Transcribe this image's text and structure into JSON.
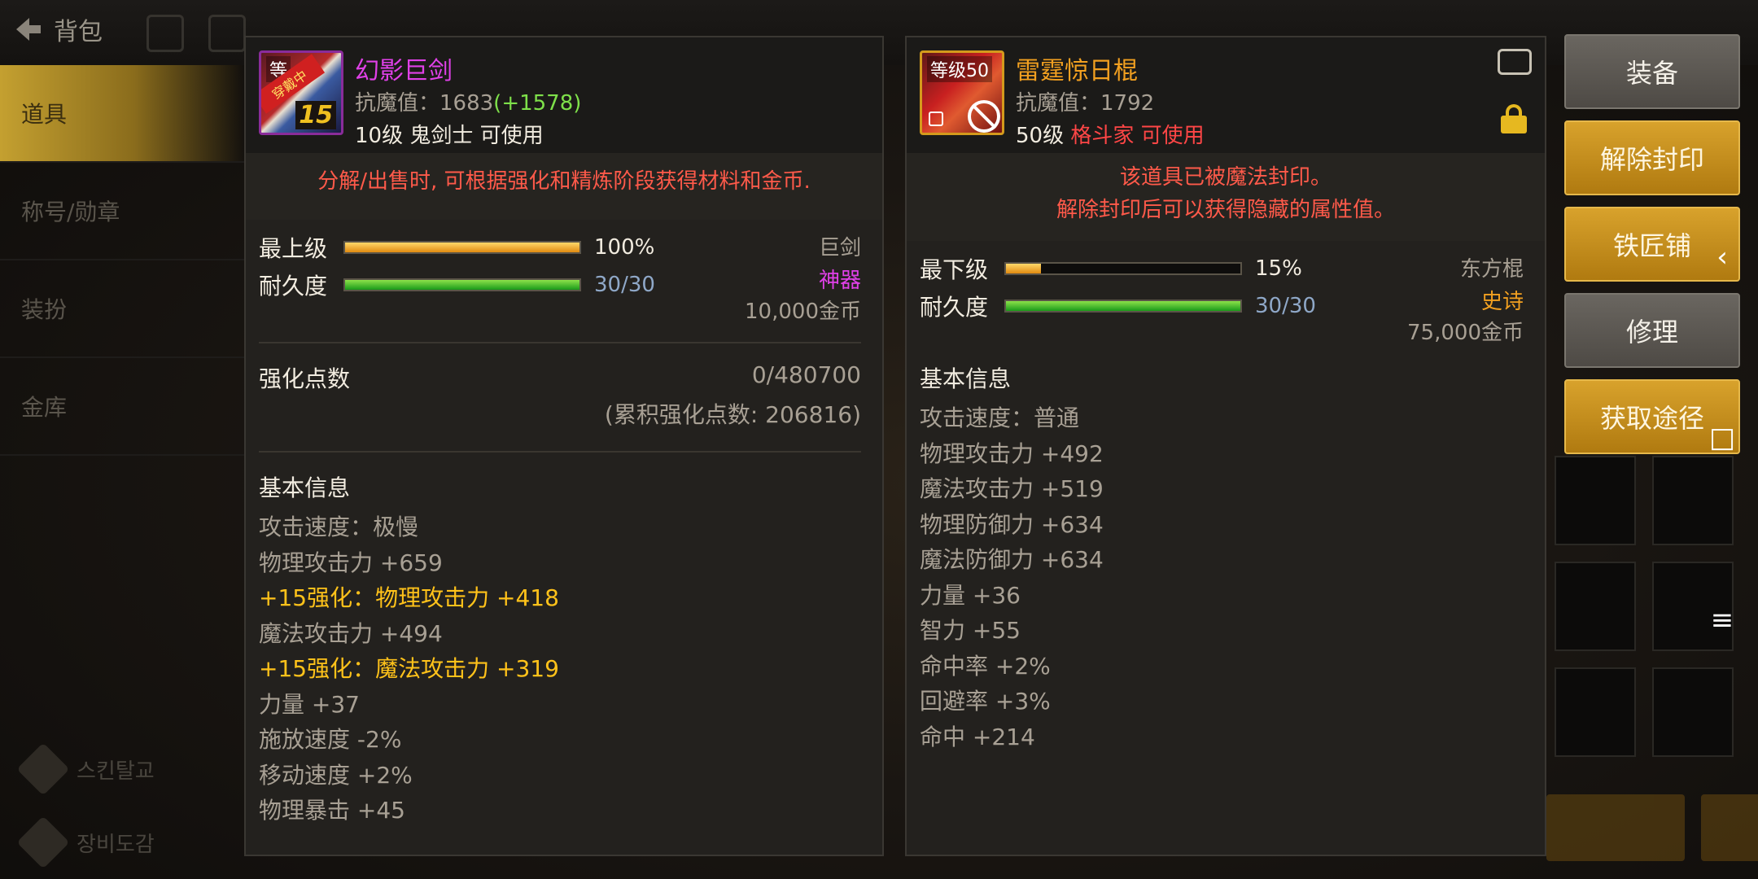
{
  "top_bar": {
    "title": "背包",
    "back_icon": "back-arrow-icon"
  },
  "left_menu": {
    "items": [
      {
        "label": "道具",
        "active": true
      },
      {
        "label": "称号/勋章",
        "active": false
      },
      {
        "label": "装扮",
        "active": false
      },
      {
        "label": "金库",
        "active": false
      }
    ],
    "bottom": [
      {
        "label": "스킨탈교"
      },
      {
        "label": "장비도감"
      }
    ]
  },
  "left_item": {
    "icon_level": "等",
    "icon_ribbon": "穿戴中",
    "icon_enhance": "15",
    "name": "幻影巨剑",
    "name_color": "#e040e8",
    "resist_label": "抗魔值：1683",
    "resist_bonus": "(+1578)",
    "req_level": "10级",
    "req_class": "鬼剑士",
    "req_usable": "可使用",
    "notice": "分解/出售时, 可根据强化和精炼阶段获得材料和金币.",
    "grade_label": "最上级",
    "grade_pct": "100%",
    "grade_value": 1.0,
    "durability_label": "耐久度",
    "durability_text": "30/30",
    "durability_value": 1.0,
    "type": "巨剑",
    "rarity": "神器",
    "price": "10,000金币",
    "enh_label": "强化点数",
    "enh_value": "0/480700",
    "enh_accum": "(累积强化点数: 206816)",
    "info_title": "基本信息",
    "info_lines": [
      {
        "text": "攻击速度：极慢",
        "gold": false
      },
      {
        "text": "物理攻击力 +659",
        "gold": false
      },
      {
        "text": "+15强化：物理攻击力 +418",
        "gold": true
      },
      {
        "text": "魔法攻击力 +494",
        "gold": false
      },
      {
        "text": "+15强化：魔法攻击力 +319",
        "gold": true
      },
      {
        "text": "力量 +37",
        "gold": false
      },
      {
        "text": "施放速度 -2%",
        "gold": false
      },
      {
        "text": "移动速度 +2%",
        "gold": false
      },
      {
        "text": "物理暴击 +45",
        "gold": false
      }
    ]
  },
  "right_item": {
    "icon_level": "等级50",
    "name": "雷霆惊日棍",
    "name_color": "#f2a020",
    "resist_label": "抗魔值：1792",
    "req_level": "50级",
    "req_class": "格斗家",
    "req_usable": "可使用",
    "notice_line1": "该道具已被魔法封印。",
    "notice_line2": "解除封印后可以获得隐藏的属性值。",
    "grade_label": "最下级",
    "grade_pct": "15%",
    "grade_value": 0.15,
    "durability_label": "耐久度",
    "durability_text": "30/30",
    "durability_value": 1.0,
    "type": "东方棍",
    "rarity": "史诗",
    "price": "75,000金币",
    "info_title": "基本信息",
    "info_lines": [
      "攻击速度：普通",
      "物理攻击力 +492",
      "魔法攻击力 +519",
      "物理防御力 +634",
      "魔法防御力 +634",
      "力量 +36",
      "智力 +55",
      "命中率 +2%",
      "回避率 +3%",
      "命中 +214"
    ]
  },
  "actions": [
    {
      "label": "装备",
      "style": "grey"
    },
    {
      "label": "解除封印",
      "style": "gold"
    },
    {
      "label": "铁匠铺",
      "style": "gold"
    },
    {
      "label": "修理",
      "style": "grey"
    },
    {
      "label": "获取途径",
      "style": "gold"
    }
  ],
  "edge": {
    "back": "‹",
    "square": "□",
    "menu": "≡"
  }
}
